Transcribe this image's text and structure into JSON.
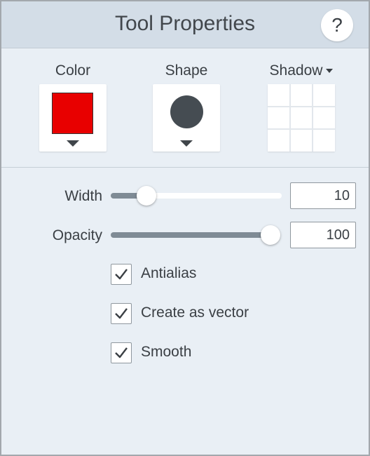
{
  "header": {
    "title": "Tool Properties",
    "help_label": "?"
  },
  "tools": {
    "color": {
      "label": "Color",
      "value_color": "#e80000"
    },
    "shape": {
      "label": "Shape",
      "value": "circle"
    },
    "shadow": {
      "label": "Shadow"
    }
  },
  "width": {
    "label": "Width",
    "value": "10",
    "slider_fraction": 0.21
  },
  "opacity": {
    "label": "Opacity",
    "value": "100",
    "slider_fraction": 1.0
  },
  "options": [
    {
      "label": "Antialias",
      "checked": true
    },
    {
      "label": "Create as vector",
      "checked": true
    },
    {
      "label": "Smooth",
      "checked": true
    }
  ],
  "colors": {
    "panel_bg": "#e9eff5",
    "header_bg": "#d3dde7",
    "slider_fill": "#7f8b95"
  }
}
